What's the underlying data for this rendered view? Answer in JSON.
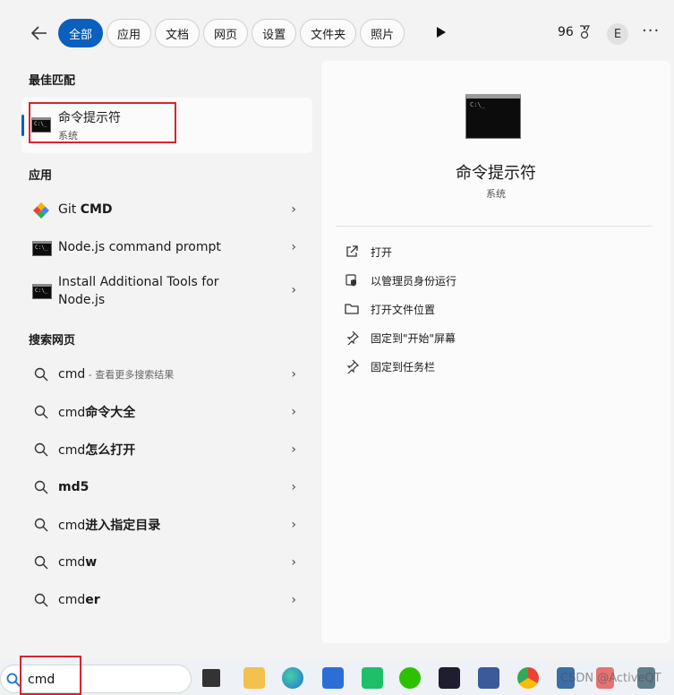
{
  "top": {
    "filters": [
      "全部",
      "应用",
      "文档",
      "网页",
      "设置",
      "文件夹",
      "照片"
    ],
    "score": "96",
    "avatar_letter": "E",
    "more": "···"
  },
  "left": {
    "best_match_title": "最佳匹配",
    "best_match": {
      "name": "命令提示符",
      "subtitle": "系统"
    },
    "apps_title": "应用",
    "apps": [
      {
        "pre": "Git ",
        "bold": "CMD",
        "icon": "git-cmd-icon"
      },
      {
        "pre": "Node.js command prompt",
        "bold": "",
        "icon": "nodejs-prompt-icon"
      },
      {
        "pre": "Install Additional Tools for Node.js",
        "bold": "",
        "icon": "install-tools-icon"
      }
    ],
    "web_title": "搜索网页",
    "web": [
      {
        "pre": "cmd",
        "bold": "",
        "hint": " - 查看更多搜索结果"
      },
      {
        "pre": "cmd",
        "bold": "命令大全",
        "hint": ""
      },
      {
        "pre": "cmd",
        "bold": "怎么打开",
        "hint": ""
      },
      {
        "pre": "",
        "bold": "md5",
        "hint": ""
      },
      {
        "pre": "cmd",
        "bold": "进入指定目录",
        "hint": ""
      },
      {
        "pre": "cmd",
        "bold": "w",
        "hint": ""
      },
      {
        "pre": "cmd",
        "bold": "er",
        "hint": ""
      }
    ]
  },
  "right": {
    "title": "命令提示符",
    "subtitle": "系统",
    "actions": [
      {
        "label": "打开",
        "icon": "open-icon"
      },
      {
        "label": "以管理员身份运行",
        "icon": "admin-shield-icon"
      },
      {
        "label": "打开文件位置",
        "icon": "folder-icon"
      },
      {
        "label": "固定到\"开始\"屏幕",
        "icon": "pin-start-icon"
      },
      {
        "label": "固定到任务栏",
        "icon": "pin-taskbar-icon"
      }
    ]
  },
  "taskbar": {
    "search_value": "cmd",
    "watermark": "CSDN @ActiveQT"
  },
  "colors": {
    "accent": "#0b5fbd",
    "highlight_box": "#d9232d"
  }
}
